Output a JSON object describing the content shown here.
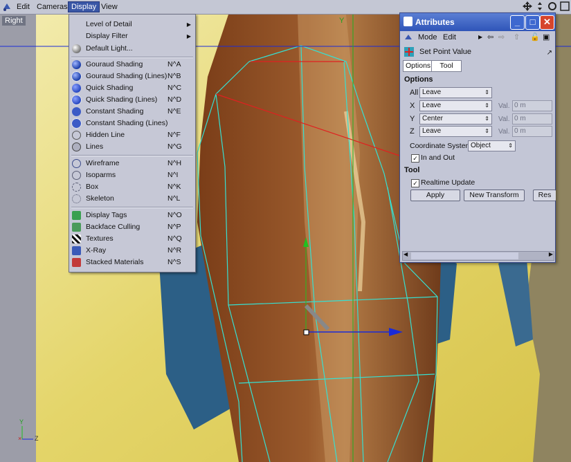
{
  "menu_bar": {
    "items": [
      "Edit",
      "Cameras",
      "Display",
      "View"
    ],
    "active": "Display"
  },
  "viewport": {
    "label": "Right",
    "axis_y": "Y",
    "axis_small_y": "Y",
    "axis_small_z": "Z",
    "colors": {
      "grid": "#36e0d2",
      "selection": "#e02020",
      "axis_x": "#1a2ad8",
      "axis_y": "#20c020"
    }
  },
  "display_menu": {
    "items": [
      {
        "label": "Level of Detail",
        "shortcut": "",
        "submenu": true,
        "icon": "none"
      },
      {
        "label": "Display Filter",
        "shortcut": "",
        "submenu": true,
        "icon": "none"
      },
      {
        "label": "Default Light...",
        "shortcut": "",
        "submenu": false,
        "icon": "light-sphere-icon"
      },
      {
        "label": "Gouraud Shading",
        "shortcut": "N^A",
        "icon": "gouraud-sphere-icon"
      },
      {
        "label": "Gouraud Shading (Lines)",
        "shortcut": "N^B",
        "icon": "gouraud-lines-icon"
      },
      {
        "label": "Quick Shading",
        "shortcut": "N^C",
        "icon": "quick-sphere-icon"
      },
      {
        "label": "Quick Shading (Lines)",
        "shortcut": "N^D",
        "icon": "quick-lines-icon"
      },
      {
        "label": "Constant Shading",
        "shortcut": "N^E",
        "icon": "constant-sphere-icon"
      },
      {
        "label": "Constant Shading (Lines)",
        "shortcut": "",
        "icon": "constant-lines-icon"
      },
      {
        "label": "Hidden Line",
        "shortcut": "N^F",
        "icon": "hidden-line-icon"
      },
      {
        "label": "Lines",
        "shortcut": "N^G",
        "icon": "lines-icon"
      },
      {
        "label": "Wireframe",
        "shortcut": "N^H",
        "icon": "wireframe-icon"
      },
      {
        "label": "Isoparms",
        "shortcut": "N^I",
        "icon": "isoparms-icon"
      },
      {
        "label": "Box",
        "shortcut": "N^K",
        "icon": "box-icon"
      },
      {
        "label": "Skeleton",
        "shortcut": "N^L",
        "icon": "skeleton-icon"
      },
      {
        "label": "Display Tags",
        "shortcut": "N^O",
        "icon": "display-tags-icon"
      },
      {
        "label": "Backface Culling",
        "shortcut": "N^P",
        "icon": "backface-culling-icon"
      },
      {
        "label": "Textures",
        "shortcut": "N^Q",
        "icon": "textures-icon"
      },
      {
        "label": "X-Ray",
        "shortcut": "N^R",
        "icon": "xray-icon"
      },
      {
        "label": "Stacked Materials",
        "shortcut": "N^S",
        "icon": "stacked-materials-icon"
      }
    ]
  },
  "attributes": {
    "title": "Attributes",
    "menu": {
      "mode": "Mode",
      "edit": "Edit"
    },
    "tool_name": "Set Point Value",
    "tabs": [
      "Options",
      "Tool"
    ],
    "options_heading": "Options",
    "rows": [
      {
        "axis": "All",
        "value": "Leave"
      },
      {
        "axis": "X",
        "value": "Leave",
        "val_label": "Val.",
        "val": "0 m"
      },
      {
        "axis": "Y",
        "value": "Center",
        "val_label": "Val.",
        "val": "0 m"
      },
      {
        "axis": "Z",
        "value": "Leave",
        "val_label": "Val.",
        "val": "0 m"
      }
    ],
    "coordinate_system_label": "Coordinate System",
    "coordinate_system_value": "Object",
    "in_and_out_label": "In and Out",
    "in_and_out_checked": true,
    "tool_heading": "Tool",
    "realtime_label": "Realtime Update",
    "realtime_checked": true,
    "buttons": {
      "apply": "Apply",
      "new_transform": "New Transform",
      "reset": "Res"
    }
  }
}
